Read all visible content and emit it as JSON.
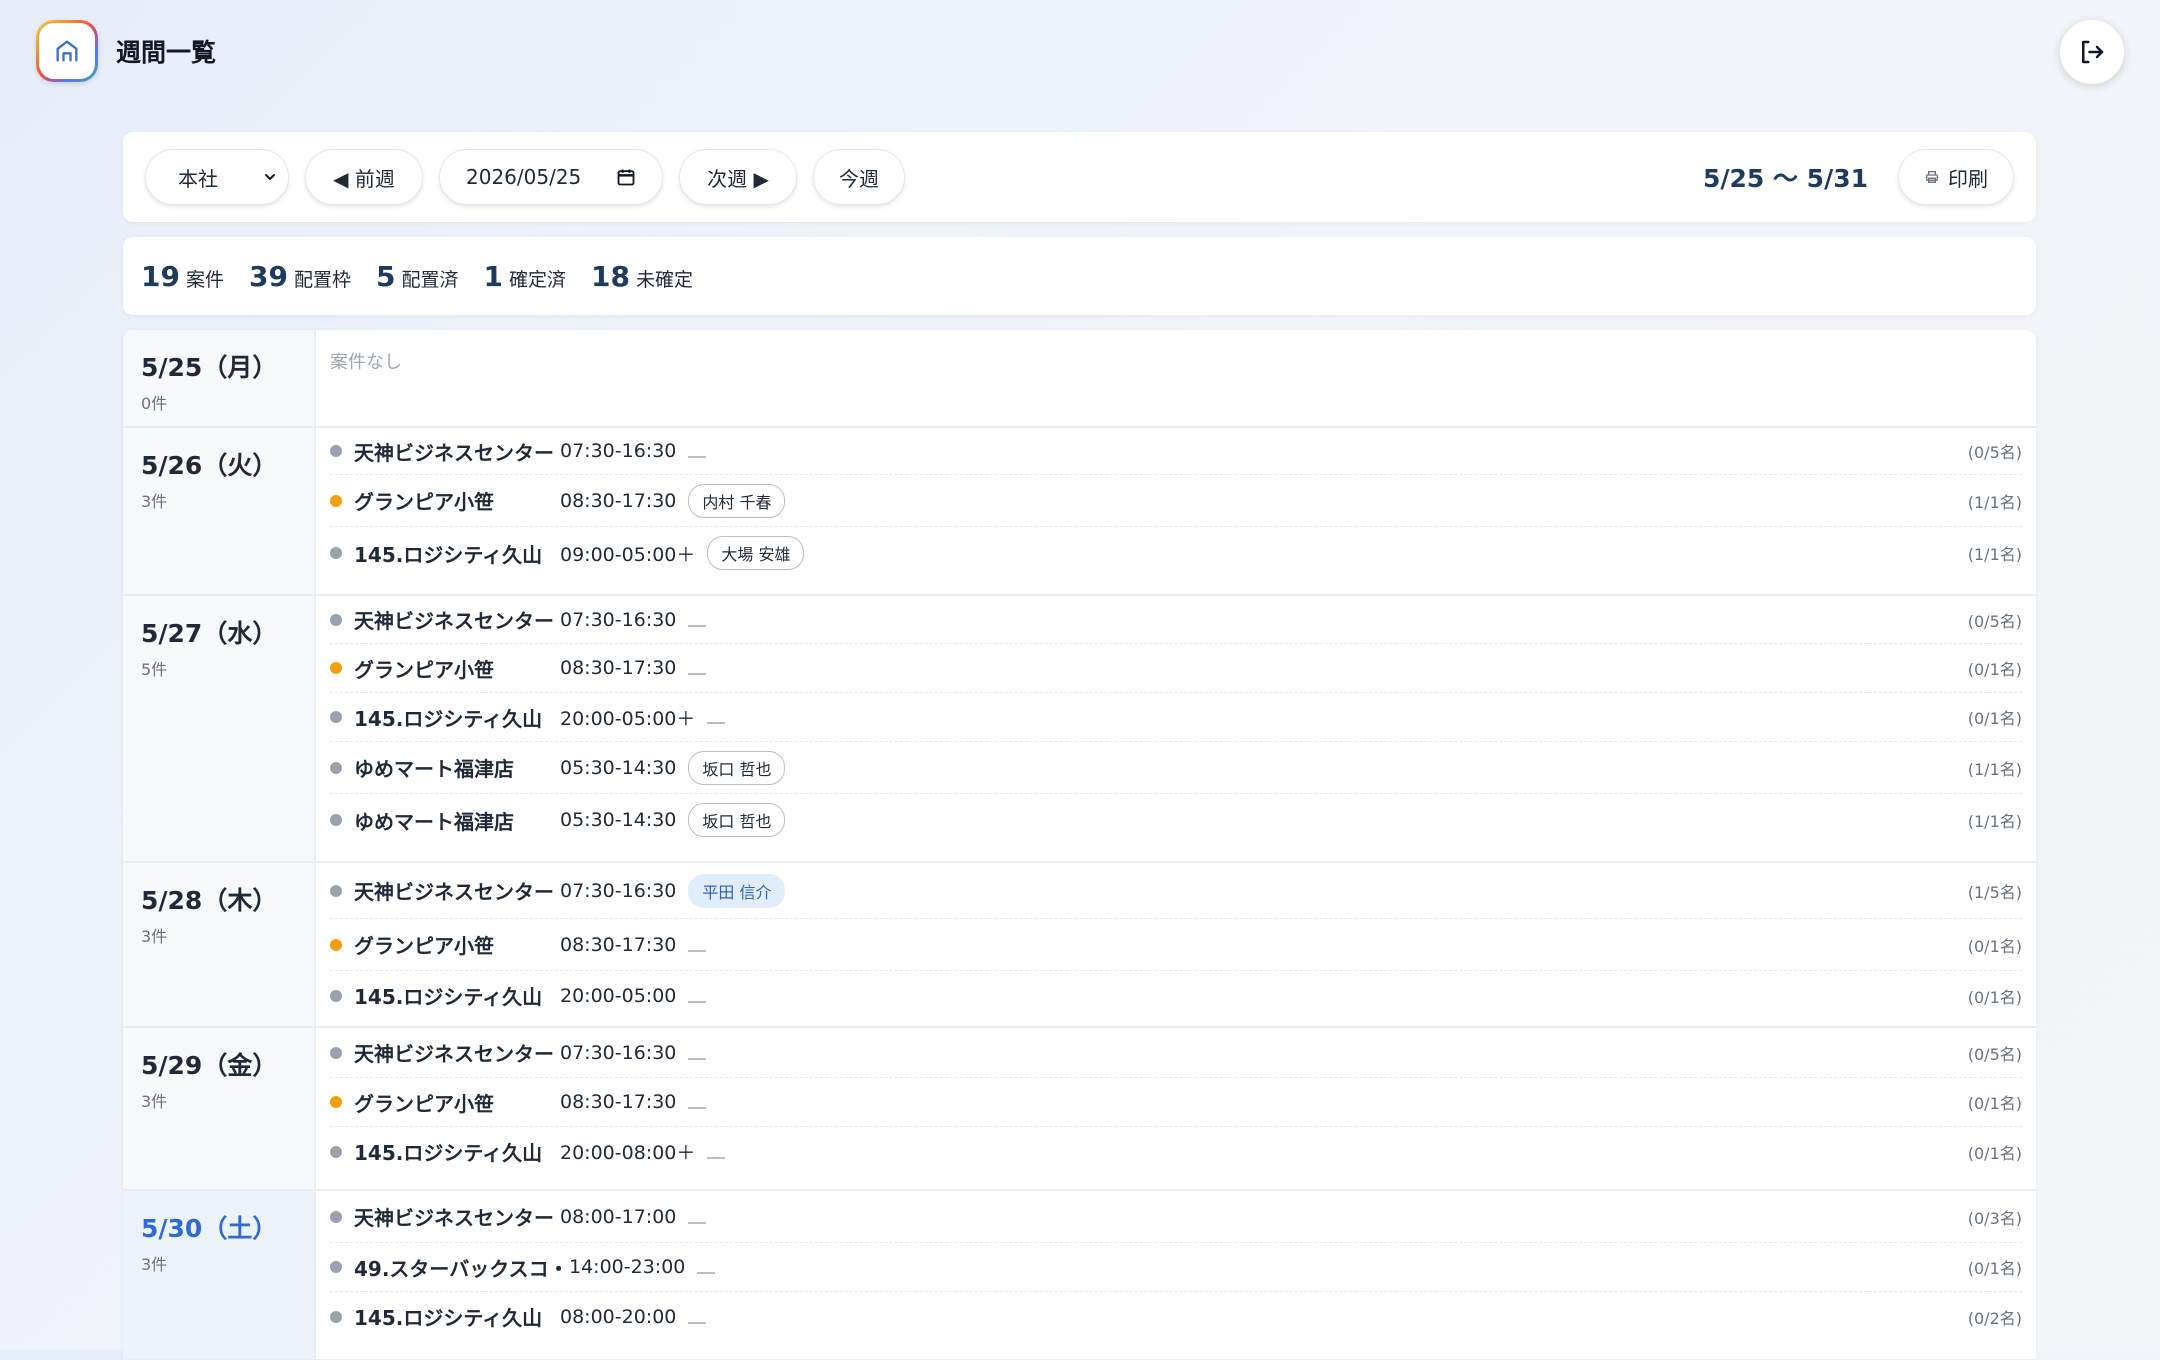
{
  "header": {
    "title": "週間一覧"
  },
  "toolbar": {
    "branch": "本社",
    "prev_label": "◀ 前週",
    "date_value": "2026/05/25",
    "next_label": "次週 ▶",
    "this_week_label": "今週",
    "range": "5/25 〜 5/31",
    "print_label": "印刷"
  },
  "stats": [
    {
      "value": "19",
      "label": "案件"
    },
    {
      "value": "39",
      "label": "配置枠"
    },
    {
      "value": "5",
      "label": "配置済"
    },
    {
      "value": "1",
      "label": "確定済"
    },
    {
      "value": "18",
      "label": "未確定"
    }
  ],
  "days": [
    {
      "label": "5/25（月）",
      "count": "0件",
      "empty": "案件なし",
      "jobs": []
    },
    {
      "label": "5/26（火）",
      "count": "3件",
      "jobs": [
        {
          "site": "天神ビジネスセンター",
          "time": "07:30-16:30",
          "staff": "",
          "slots": "(0/5名)",
          "dot": "gray"
        },
        {
          "site": "グランピア小笹",
          "time": "08:30-17:30",
          "staff": "内村 千春",
          "slots": "(1/1名)",
          "dot": "orange"
        },
        {
          "site": "145.ロジシティ久山",
          "time": "09:00-05:00＋",
          "staff": "大場 安雄",
          "slots": "(1/1名)",
          "dot": "gray"
        }
      ]
    },
    {
      "label": "5/27（水）",
      "count": "5件",
      "jobs": [
        {
          "site": "天神ビジネスセンター",
          "time": "07:30-16:30",
          "staff": "",
          "slots": "(0/5名)",
          "dot": "gray"
        },
        {
          "site": "グランピア小笹",
          "time": "08:30-17:30",
          "staff": "",
          "slots": "(0/1名)",
          "dot": "orange"
        },
        {
          "site": "145.ロジシティ久山",
          "time": "20:00-05:00＋",
          "staff": "",
          "slots": "(0/1名)",
          "dot": "gray"
        },
        {
          "site": "ゆめマート福津店",
          "time": "05:30-14:30",
          "staff": "坂口 哲也",
          "slots": "(1/1名)",
          "dot": "gray"
        },
        {
          "site": "ゆめマート福津店",
          "time": "05:30-14:30",
          "staff": "坂口 哲也",
          "slots": "(1/1名)",
          "dot": "gray"
        }
      ]
    },
    {
      "label": "5/28（木）",
      "count": "3件",
      "jobs": [
        {
          "site": "天神ビジネスセンター",
          "time": "07:30-16:30",
          "staff": "平田 信介",
          "staff_confirmed": true,
          "slots": "(1/5名)",
          "dot": "gray"
        },
        {
          "site": "グランピア小笹",
          "time": "08:30-17:30",
          "staff": "",
          "slots": "(0/1名)",
          "dot": "orange"
        },
        {
          "site": "145.ロジシティ久山",
          "time": "20:00-05:00",
          "staff": "",
          "slots": "(0/1名)",
          "dot": "gray"
        }
      ]
    },
    {
      "label": "5/29（金）",
      "count": "3件",
      "jobs": [
        {
          "site": "天神ビジネスセンター",
          "time": "07:30-16:30",
          "staff": "",
          "slots": "(0/5名)",
          "dot": "gray"
        },
        {
          "site": "グランピア小笹",
          "time": "08:30-17:30",
          "staff": "",
          "slots": "(0/1名)",
          "dot": "orange"
        },
        {
          "site": "145.ロジシティ久山",
          "time": "20:00-08:00＋",
          "staff": "",
          "slots": "(0/1名)",
          "dot": "gray"
        }
      ]
    },
    {
      "label": "5/30（土）",
      "count": "3件",
      "saturday": true,
      "jobs": [
        {
          "site": "天神ビジネスセンター",
          "time": "08:00-17:00",
          "staff": "",
          "slots": "(0/3名)",
          "dot": "gray"
        },
        {
          "site": "49.スターバックスコ・",
          "time": "14:00-23:00",
          "staff": "",
          "slots": "(0/1名)",
          "dot": "gray"
        },
        {
          "site": "145.ロジシティ久山",
          "time": "08:00-20:00",
          "staff": "",
          "slots": "(0/2名)",
          "dot": "gray"
        }
      ]
    }
  ]
}
